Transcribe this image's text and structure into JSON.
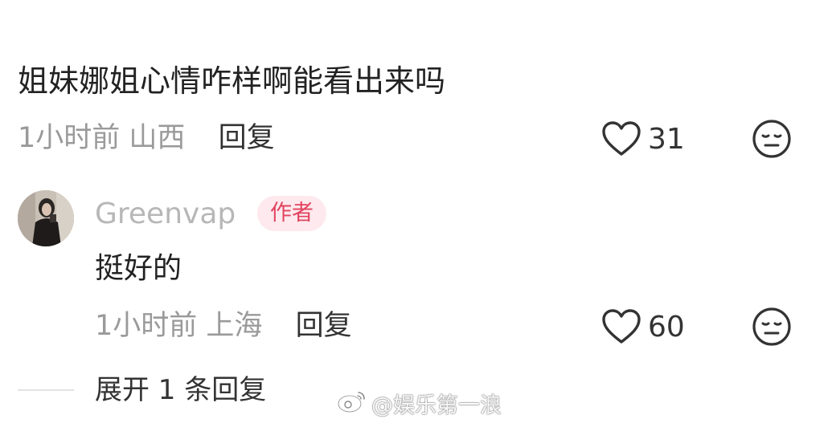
{
  "comment": {
    "text": "姐妹娜姐心情咋样啊能看出来吗",
    "time": "1小时前",
    "location": "山西",
    "reply_label": "回复",
    "like_count": "31",
    "like_icon": "heart-outline-icon",
    "dislike_icon": "meh-face-icon"
  },
  "reply": {
    "author_name": "Greenvap",
    "author_badge": "作者",
    "text": "挺好的",
    "time": "1小时前",
    "location": "上海",
    "reply_label": "回复",
    "like_count": "60",
    "like_icon": "heart-outline-icon",
    "dislike_icon": "meh-face-icon"
  },
  "expand_replies": "展开 1 条回复",
  "watermark": {
    "icon": "weibo-logo-icon",
    "text": "@娱乐第一浪"
  },
  "colors": {
    "text_primary": "#222222",
    "text_secondary": "#9a9a9a",
    "author_name": "#b7b7b7",
    "badge_bg": "#fde9ee",
    "badge_text": "#e2435f"
  }
}
